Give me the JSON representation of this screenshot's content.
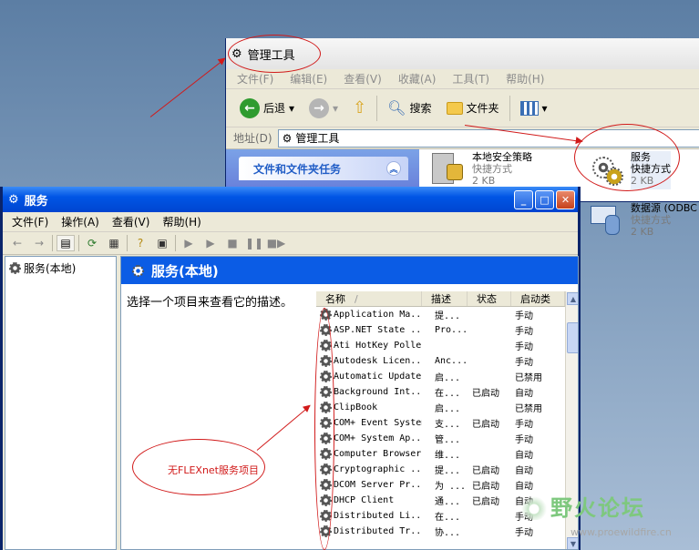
{
  "back_window": {
    "title": "管理工具",
    "menu": [
      "文件(F)",
      "编辑(E)",
      "查看(V)",
      "收藏(A)",
      "工具(T)",
      "帮助(H)"
    ],
    "toolbar": {
      "back": "后退",
      "search": "搜索",
      "folders": "文件夹"
    },
    "address": {
      "label": "地址(D)",
      "value": "管理工具"
    },
    "task_pane": {
      "header": "文件和文件夹任务",
      "collapse_glyph": "︽"
    },
    "files": [
      {
        "name": "本地安全策略",
        "type": "快捷方式",
        "size": "2 KB"
      },
      {
        "name": "服务",
        "type": "快捷方式",
        "size": "2 KB"
      },
      {
        "name": "数据源 (ODBC",
        "type": "快捷方式",
        "size": "2 KB"
      }
    ]
  },
  "services_window": {
    "title": "服务",
    "menu": [
      "文件(F)",
      "操作(A)",
      "查看(V)",
      "帮助(H)"
    ],
    "tree_item": "服务(本地)",
    "header": "服务(本地)",
    "description": "选择一个项目来查看它的描述。",
    "columns": [
      "名称",
      "描述",
      "状态",
      "启动类"
    ],
    "rows": [
      {
        "name": "Application Ma...",
        "desc": "提...",
        "status": "",
        "startup": "手动"
      },
      {
        "name": "ASP.NET State ...",
        "desc": "Pro...",
        "status": "",
        "startup": "手动"
      },
      {
        "name": "Ati HotKey Poller",
        "desc": "",
        "status": "",
        "startup": "手动"
      },
      {
        "name": "Autodesk Licen...",
        "desc": "Anc...",
        "status": "",
        "startup": "手动"
      },
      {
        "name": "Automatic Updates",
        "desc": "启...",
        "status": "",
        "startup": "已禁用"
      },
      {
        "name": "Background Int...",
        "desc": "在...",
        "status": "已启动",
        "startup": "自动"
      },
      {
        "name": "ClipBook",
        "desc": "启...",
        "status": "",
        "startup": "已禁用"
      },
      {
        "name": "COM+ Event System",
        "desc": "支...",
        "status": "已启动",
        "startup": "手动"
      },
      {
        "name": "COM+ System Ap...",
        "desc": "管...",
        "status": "",
        "startup": "手动"
      },
      {
        "name": "Computer Browser",
        "desc": "维...",
        "status": "",
        "startup": "自动"
      },
      {
        "name": "Cryptographic ...",
        "desc": "提...",
        "status": "已启动",
        "startup": "自动"
      },
      {
        "name": "DCOM Server Pr...",
        "desc": "为 ...",
        "status": "已启动",
        "startup": "自动"
      },
      {
        "name": "DHCP Client",
        "desc": "通...",
        "status": "已启动",
        "startup": "自动"
      },
      {
        "name": "Distributed Li...",
        "desc": "在...",
        "status": "",
        "startup": "手动"
      },
      {
        "name": "Distributed Tr...",
        "desc": "协...",
        "status": "",
        "startup": "手动"
      }
    ]
  },
  "annotation": {
    "note": "无FLEXnet服务项目",
    "color": "#d11a1a"
  },
  "watermark": {
    "text": "野火论坛",
    "url": "www.proewildfire.cn"
  }
}
